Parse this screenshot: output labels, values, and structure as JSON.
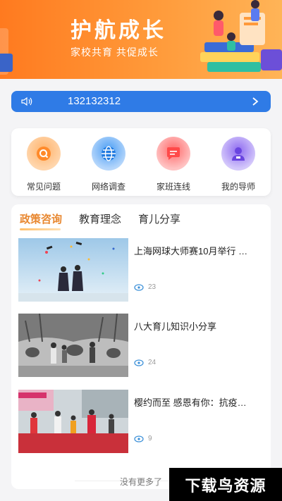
{
  "banner": {
    "title": "护航成长",
    "subtitle": "家校共育  共促成长"
  },
  "notice": {
    "text": "132132312"
  },
  "quick_menu": [
    {
      "label": "常见问题",
      "icon": "help-icon",
      "color": "#ff9b4a"
    },
    {
      "label": "网络调查",
      "icon": "globe-icon",
      "color": "#2f86ea"
    },
    {
      "label": "家班连线",
      "icon": "chat-icon",
      "color": "#ff5a5a"
    },
    {
      "label": "我的导师",
      "icon": "teacher-icon",
      "color": "#7b55e8"
    }
  ],
  "tabs": [
    {
      "label": "政策咨询",
      "active": true
    },
    {
      "label": "教育理念",
      "active": false
    },
    {
      "label": "育儿分享",
      "active": false
    }
  ],
  "articles": [
    {
      "title": "上海网球大师赛10月举行 亲…",
      "views": "23",
      "image": "graduation-photo"
    },
    {
      "title": "八大育儿知识小分享",
      "views": "24",
      "image": "street-crowd-photo"
    },
    {
      "title": "樱约而至 感恩有你：抗疫医…",
      "views": "9",
      "image": "welcome-ceremony-photo"
    }
  ],
  "footer": {
    "no_more": "没有更多了"
  },
  "watermark": {
    "text": "下载鸟资源"
  },
  "colors": {
    "banner": "#ff8a2a",
    "notice_bar": "#2f7be6",
    "active_tab": "#e8872f"
  }
}
